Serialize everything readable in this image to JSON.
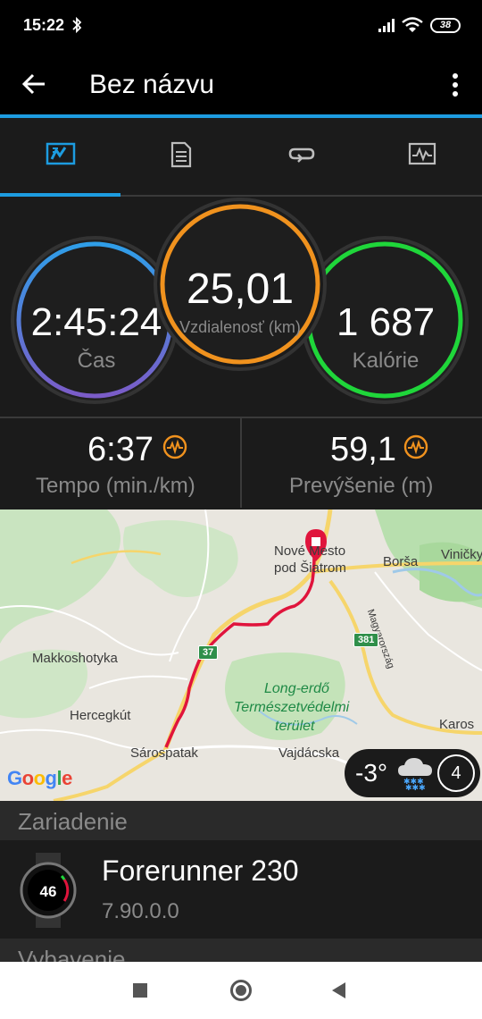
{
  "status_bar": {
    "time": "15:22",
    "battery": "38"
  },
  "app_bar": {
    "title": "Bez názvu"
  },
  "tabs": [
    {
      "name": "overview",
      "icon": "overview-chart-icon",
      "active": true
    },
    {
      "name": "details",
      "icon": "document-list-icon",
      "active": false
    },
    {
      "name": "laps",
      "icon": "loop-arrows-icon",
      "active": false
    },
    {
      "name": "charts",
      "icon": "line-graph-icon",
      "active": false
    }
  ],
  "stats": {
    "time": {
      "value": "2:45:24",
      "label": "Čas"
    },
    "distance": {
      "value": "25,01",
      "label": "Vzdialenosť (km)"
    },
    "calories": {
      "value": "1 687",
      "label": "Kalórie"
    }
  },
  "sub_stats": {
    "tempo": {
      "value": "6:37",
      "label": "Tempo (min./km)"
    },
    "elevation": {
      "value": "59,1",
      "label": "Prevýšenie (m)"
    }
  },
  "map": {
    "places": {
      "novemesto": "Nové Mesto",
      "podsiatrom": "pod Šiatrom",
      "borsa": "Borša",
      "vinicky": "Viničky",
      "makkoshotyka": "Makkoshotyka",
      "longerdo1": "Long-erdő",
      "longerdo2": "Természetvédelmi",
      "longerdo3": "terület",
      "hercegkut": "Hercegkút",
      "sarospatak": "Sárospatak",
      "vajdacska": "Vajdácska",
      "karos": "Karos",
      "magyarorszag": "Magyarország"
    },
    "roads": {
      "r37": "37",
      "r381": "381"
    },
    "attribution": "Google",
    "weather": {
      "temperature": "-3°",
      "wind": "4",
      "icon": "snow-cloud-icon"
    }
  },
  "device_section": {
    "title": "Zariadenie",
    "device_name": "Forerunner 230",
    "version": "7.90.0.0",
    "watch_display": "46"
  },
  "next_section": {
    "title": "Vybavenie"
  },
  "colors": {
    "accent": "#1d9ce0",
    "time_ring": "#2f9ee8",
    "time_ring_end": "#7b5cc8",
    "distance_ring": "#f0921e",
    "calories_ring": "#1fd63a",
    "tempo_icon": "#f0921e",
    "route": "#e0143c"
  }
}
